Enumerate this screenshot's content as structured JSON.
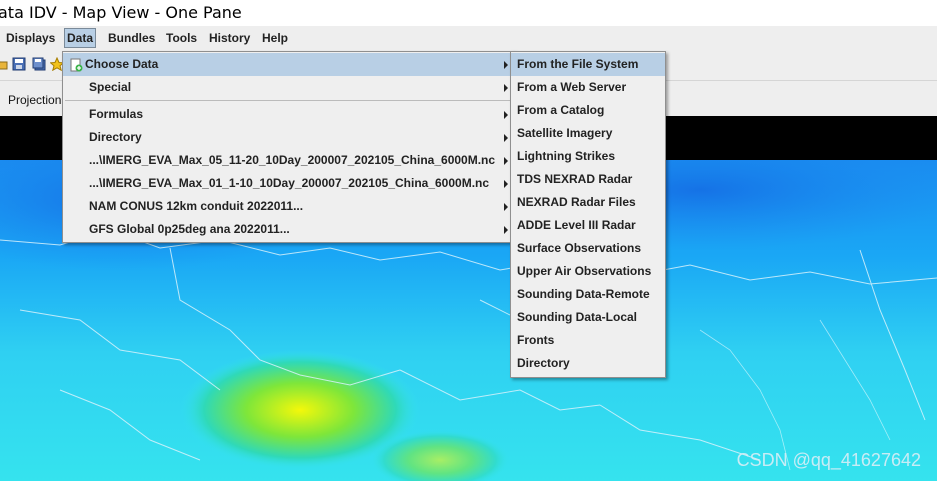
{
  "window": {
    "title": "ata IDV - Map View - One Pane"
  },
  "menubar": [
    {
      "label": "Displays",
      "name": "menu-displays"
    },
    {
      "label": "Data",
      "name": "menu-data"
    },
    {
      "label": "Bundles",
      "name": "menu-bundles"
    },
    {
      "label": "Tools",
      "name": "menu-tools"
    },
    {
      "label": "History",
      "name": "menu-history"
    },
    {
      "label": "Help",
      "name": "menu-help"
    }
  ],
  "toolbar_icons": [
    "open-folder-icon",
    "save-icon",
    "save-as-icon",
    "favorite-star-icon"
  ],
  "subbar": {
    "projection_label": "Projection"
  },
  "data_menu": {
    "items": [
      {
        "label": "Choose Data",
        "submenu": true,
        "highlighted": true,
        "icon": "add-data-icon"
      },
      {
        "label": "Special",
        "submenu": true
      },
      {
        "label": "Formulas",
        "submenu": true
      },
      {
        "label": "Directory",
        "submenu": true
      },
      {
        "label": "...\\IMERG_EVA_Max_05_11-20_10Day_200007_202105_China_6000M.nc",
        "submenu": true
      },
      {
        "label": "...\\IMERG_EVA_Max_01_1-10_10Day_200007_202105_China_6000M.nc",
        "submenu": true
      },
      {
        "label": "NAM CONUS 12km conduit 2022011...",
        "submenu": true
      },
      {
        "label": "GFS Global 0p25deg ana 2022011...",
        "submenu": true
      }
    ]
  },
  "choose_data_submenu": {
    "items": [
      {
        "label": "From the File System",
        "highlighted": true
      },
      {
        "label": "From a Web Server"
      },
      {
        "label": "From a Catalog"
      },
      {
        "label": "Satellite Imagery"
      },
      {
        "label": "Lightning Strikes"
      },
      {
        "label": "TDS NEXRAD Radar"
      },
      {
        "label": "NEXRAD Radar Files"
      },
      {
        "label": "ADDE Level III Radar"
      },
      {
        "label": "Surface Observations"
      },
      {
        "label": "Upper Air Observations"
      },
      {
        "label": "Sounding Data-Remote"
      },
      {
        "label": "Sounding Data-Local"
      },
      {
        "label": "Fronts"
      },
      {
        "label": "Directory"
      }
    ]
  },
  "watermark": "CSDN @qq_41627642",
  "colors": {
    "menu_highlight": "#b8cfe5",
    "menu_bg": "#efefef",
    "map_blue": "#1a8cf0",
    "map_cyan": "#35e3ee"
  }
}
